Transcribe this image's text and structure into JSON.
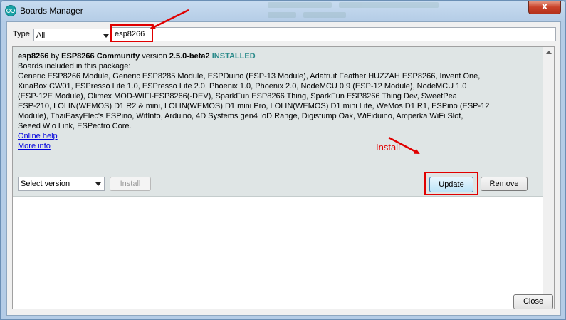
{
  "window": {
    "title": "Boards Manager",
    "close_glyph": "x"
  },
  "filter": {
    "type_label": "Type",
    "type_value": "All",
    "search_value": "esp8266"
  },
  "entry": {
    "name": "esp8266",
    "by_text": " by ",
    "author": "ESP8266 Community",
    "version_text": " version ",
    "version": "2.5.0-beta2",
    "status": "INSTALLED",
    "boards_header": "Boards included in this package:",
    "boards_lines": [
      "Generic ESP8266 Module, Generic ESP8285 Module, ESPDuino (ESP-13 Module), Adafruit Feather HUZZAH ESP8266, Invent One,",
      "XinaBox CW01, ESPresso Lite 1.0, ESPresso Lite 2.0, Phoenix 1.0, Phoenix 2.0, NodeMCU 0.9 (ESP-12 Module), NodeMCU 1.0",
      "(ESP-12E Module), Olimex MOD-WIFI-ESP8266(-DEV), SparkFun ESP8266 Thing, SparkFun ESP8266 Thing Dev, SweetPea",
      "ESP-210, LOLIN(WEMOS) D1 R2 & mini, LOLIN(WEMOS) D1 mini Pro, LOLIN(WEMOS) D1 mini Lite, WeMos D1 R1, ESPino (ESP-12",
      "Module), ThaiEasyElec's ESPino, WifInfo, Arduino, 4D Systems gen4 IoD Range, Digistump Oak, WiFiduino, Amperka WiFi Slot,",
      "Seeed Wio Link, ESPectro Core."
    ],
    "online_help": "Online help",
    "more_info": "More info",
    "select_version": "Select version",
    "install_label": "Install",
    "update_label": "Update",
    "remove_label": "Remove"
  },
  "annotation": {
    "install_note": "Install",
    "color": "#e00000"
  },
  "footer": {
    "close_label": "Close"
  },
  "colors": {
    "installed": "#2a8a8a",
    "link": "#0000dd",
    "highlight": "#e00000"
  }
}
